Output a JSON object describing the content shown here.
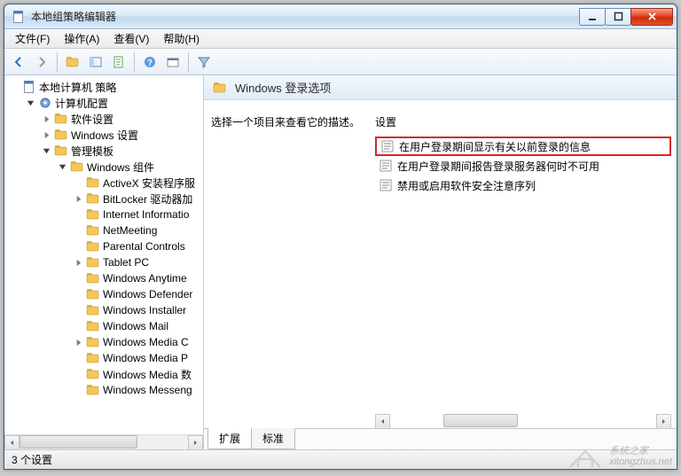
{
  "window": {
    "title": "本地组策略编辑器"
  },
  "menubar": {
    "file": "文件(F)",
    "action": "操作(A)",
    "view": "查看(V)",
    "help": "帮助(H)"
  },
  "tree": {
    "root": "本地计算机 策略",
    "items": [
      {
        "indent": 0,
        "expander": "open",
        "icon": "gear",
        "label": "计算机配置"
      },
      {
        "indent": 1,
        "expander": "closed",
        "icon": "folder",
        "label": "软件设置"
      },
      {
        "indent": 1,
        "expander": "closed",
        "icon": "folder",
        "label": "Windows 设置"
      },
      {
        "indent": 1,
        "expander": "open",
        "icon": "folder",
        "label": "管理模板"
      },
      {
        "indent": 2,
        "expander": "open",
        "icon": "folder",
        "label": "Windows 组件"
      },
      {
        "indent": 3,
        "expander": "none",
        "icon": "folder",
        "label": "ActiveX 安装程序服"
      },
      {
        "indent": 3,
        "expander": "closed",
        "icon": "folder",
        "label": "BitLocker 驱动器加"
      },
      {
        "indent": 3,
        "expander": "none",
        "icon": "folder",
        "label": "Internet Informatio"
      },
      {
        "indent": 3,
        "expander": "none",
        "icon": "folder",
        "label": "NetMeeting"
      },
      {
        "indent": 3,
        "expander": "none",
        "icon": "folder",
        "label": "Parental Controls"
      },
      {
        "indent": 3,
        "expander": "closed",
        "icon": "folder",
        "label": "Tablet PC"
      },
      {
        "indent": 3,
        "expander": "none",
        "icon": "folder",
        "label": "Windows Anytime"
      },
      {
        "indent": 3,
        "expander": "none",
        "icon": "folder",
        "label": "Windows Defender"
      },
      {
        "indent": 3,
        "expander": "none",
        "icon": "folder",
        "label": "Windows Installer"
      },
      {
        "indent": 3,
        "expander": "none",
        "icon": "folder",
        "label": "Windows Mail"
      },
      {
        "indent": 3,
        "expander": "closed",
        "icon": "folder",
        "label": "Windows Media C"
      },
      {
        "indent": 3,
        "expander": "none",
        "icon": "folder",
        "label": "Windows Media P"
      },
      {
        "indent": 3,
        "expander": "none",
        "icon": "folder",
        "label": "Windows Media 数"
      },
      {
        "indent": 3,
        "expander": "none",
        "icon": "folder",
        "label": "Windows Messeng"
      }
    ]
  },
  "content": {
    "header": "Windows 登录选项",
    "description_prompt": "选择一个项目来查看它的描述。",
    "settings_header": "设置",
    "settings": [
      {
        "label": "在用户登录期间显示有关以前登录的信息",
        "highlighted": true
      },
      {
        "label": "在用户登录期间报告登录服务器何时不可用",
        "highlighted": false
      },
      {
        "label": "禁用或启用软件安全注意序列",
        "highlighted": false
      }
    ],
    "tabs": {
      "extended": "扩展",
      "standard": "标准"
    }
  },
  "statusbar": {
    "count": "3 个设置"
  },
  "watermark": {
    "line1": "系统之家",
    "line2": "xitongzhus.net"
  }
}
